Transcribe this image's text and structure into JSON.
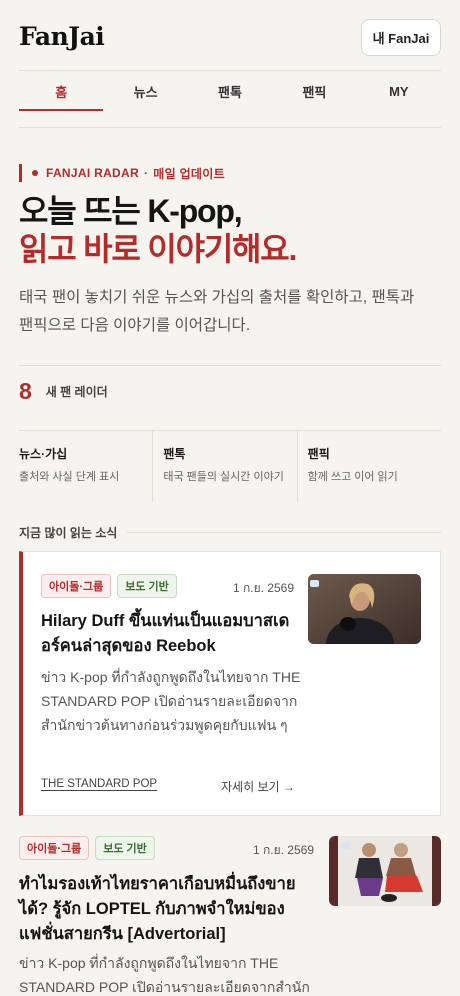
{
  "header": {
    "logo": "FanJai",
    "my_button": "내 FanJai"
  },
  "nav": {
    "tabs": [
      "홈",
      "뉴스",
      "팬톡",
      "팬픽",
      "MY"
    ],
    "active_index": 0
  },
  "hero": {
    "kicker_brand": "FANJAI RADAR",
    "kicker_sep": "·",
    "kicker_note": "매일 업데이트",
    "headline_line1": "오늘 뜨는 K-pop,",
    "headline_line2": "읽고 바로 이야기해요.",
    "intro": "태국 팬이 놓치기 쉬운 뉴스와 가십의 출처를 확인하고, 팬톡과 팬픽으로 다음 이야기를 이어갑니다."
  },
  "radar": {
    "count": "8",
    "label": "새 팬 레이더"
  },
  "features": [
    {
      "title": "뉴스·가십",
      "desc": "출처와 사실 단계 표시"
    },
    {
      "title": "팬톡",
      "desc": "태국 팬들의 실시간 이야기"
    },
    {
      "title": "팬픽",
      "desc": "함께 쓰고 이어 읽기"
    }
  ],
  "section": {
    "title": "지금 많이 읽는 소식"
  },
  "articles": [
    {
      "badges": [
        "아이돌·그룹",
        "보도 기반"
      ],
      "date": "1 ก.ย. 2569",
      "title": "Hilary Duff ขึ้นแท่นเป็นแอมบาสเดอร์คนล่าสุดของ Reebok",
      "excerpt": "ข่าว K-pop ที่กำลังถูกพูดถึงในไทยจาก THE STANDARD POP เปิดอ่านรายละเอียดจากสำนักข่าวต้นทางก่อนร่วมพูดคุยกับแฟน ๆ",
      "source": "THE STANDARD POP",
      "more": "자세히 보기 →"
    },
    {
      "badges": [
        "아이돌·그룹",
        "보도 기반"
      ],
      "date": "1 ก.ย. 2569",
      "title": "ทำไมรองเท้าไทยราคาเกือบหมื่นถึงขายได้? รู้จัก LOPTEL กับภาพจำใหม่ของแฟชั่นสายกรีน [Advertorial]",
      "excerpt": "ข่าว K-pop ที่กำลังถูกพูดถึงในไทยจาก THE STANDARD POP เปิดอ่านรายละเอียดจากสำนัก"
    }
  ],
  "colors": {
    "accent": "#b42b2b",
    "background": "#f6f4ef",
    "badge_green": "#3d6b35"
  }
}
